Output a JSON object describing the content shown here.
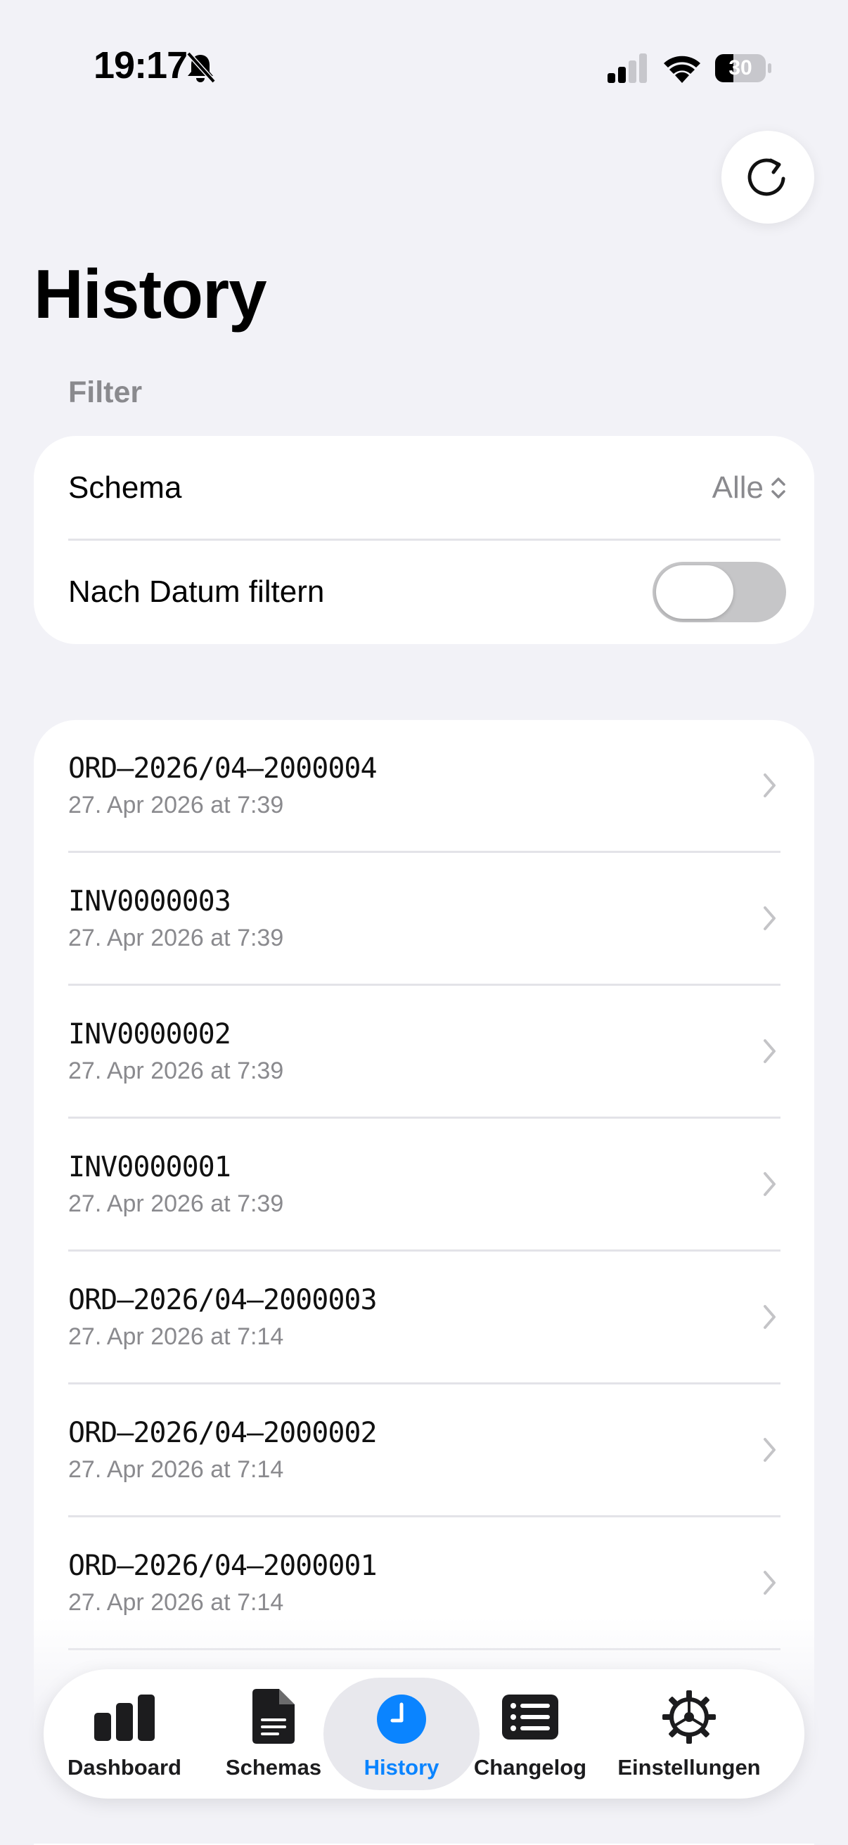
{
  "status_bar": {
    "time": "19:17",
    "battery_level": "30"
  },
  "header": {
    "title": "History"
  },
  "filter": {
    "section_label": "Filter",
    "schema_label": "Schema",
    "schema_value": "Alle",
    "date_filter_label": "Nach Datum filtern",
    "date_filter_enabled": false
  },
  "history": {
    "items": [
      {
        "title": "ORD–2026/04–2000004",
        "subtitle": "27. Apr 2026 at 7:39"
      },
      {
        "title": "INV0000003",
        "subtitle": "27. Apr 2026 at 7:39"
      },
      {
        "title": "INV0000002",
        "subtitle": "27. Apr 2026 at 7:39"
      },
      {
        "title": "INV0000001",
        "subtitle": "27. Apr 2026 at 7:39"
      },
      {
        "title": "ORD–2026/04–2000003",
        "subtitle": "27. Apr 2026 at 7:14"
      },
      {
        "title": "ORD–2026/04–2000002",
        "subtitle": "27. Apr 2026 at 7:14"
      },
      {
        "title": "ORD–2026/04–2000001",
        "subtitle": "27. Apr 2026 at 7:14"
      }
    ]
  },
  "tab_bar": {
    "tabs": [
      {
        "label": "Dashboard",
        "icon": "chart-bar-icon"
      },
      {
        "label": "Schemas",
        "icon": "document-icon"
      },
      {
        "label": "History",
        "icon": "clock-icon",
        "active": true
      },
      {
        "label": "Changelog",
        "icon": "list-icon"
      },
      {
        "label": "Einstellungen",
        "icon": "gear-icon"
      }
    ]
  },
  "colors": {
    "accent": "#0a84ff",
    "background": "#f2f2f7",
    "secondary_text": "#8a8a8e"
  }
}
